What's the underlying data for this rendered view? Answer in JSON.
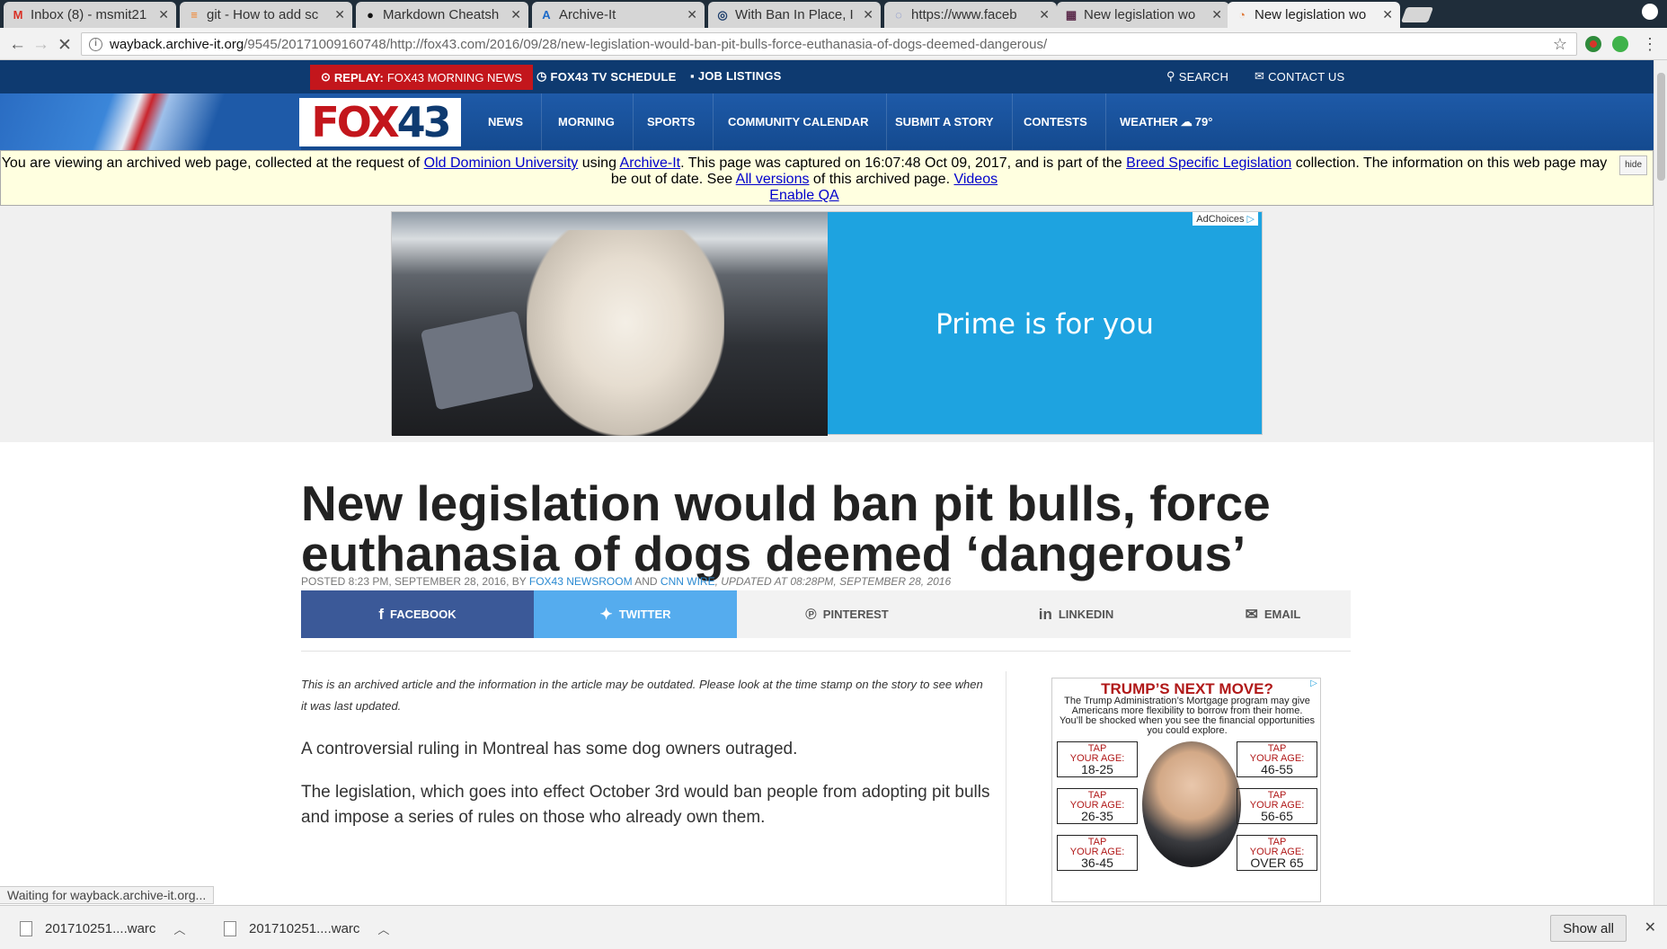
{
  "browser": {
    "tabs": [
      {
        "label": "Inbox (8) - msmit21",
        "icon": "gmail-icon",
        "icon_char": "M",
        "icon_color": "#d93025"
      },
      {
        "label": "git - How to add sc",
        "icon": "stackoverflow-icon",
        "icon_char": "≡",
        "icon_color": "#f48024"
      },
      {
        "label": "Markdown Cheatsh",
        "icon": "github-icon",
        "icon_char": "●",
        "icon_color": "#111111"
      },
      {
        "label": "Archive-It",
        "icon": "archive-it-icon",
        "icon_char": "A",
        "icon_color": "#1b6ac9"
      },
      {
        "label": "With Ban In Place, I",
        "icon": "news-site-icon",
        "icon_char": "◎",
        "icon_color": "#1d3d6b"
      },
      {
        "label": "https://www.faceb",
        "icon": "globe-icon",
        "icon_char": "◌",
        "icon_color": "#6b7ec9"
      },
      {
        "label": "New legislation wo",
        "icon": "fox43-icon",
        "icon_char": "▦",
        "icon_color": "#5a2a4a"
      },
      {
        "label": "New legislation wo",
        "icon": "loading-spinner-icon",
        "icon_char": "◔",
        "icon_color": "#e07a3a"
      }
    ],
    "address": {
      "host": "wayback.archive-it.org",
      "path": "/9545/20171009160748/http://fox43.com/2016/09/28/new-legislation-would-ban-pit-bulls-force-euthanasia-of-dogs-deemed-dangerous/"
    },
    "status_text": "Waiting for wayback.archive-it.org...",
    "downloads": [
      "201710251....warc",
      "201710251....warc"
    ],
    "show_all_label": "Show all"
  },
  "site": {
    "replay": {
      "label": "REPLAY:",
      "text": "FOX43 MORNING NEWS"
    },
    "top_links": {
      "schedule": "FOX43 TV SCHEDULE",
      "jobs": "JOB LISTINGS",
      "search": "SEARCH",
      "contact": "CONTACT US"
    },
    "logo": {
      "fox": "FOX",
      "num": "43"
    },
    "nav": [
      "NEWS",
      "MORNING",
      "SPORTS",
      "COMMUNITY CALENDAR",
      "SUBMIT A STORY",
      "CONTESTS",
      "WEATHER",
      "79°"
    ]
  },
  "archive_banner": {
    "t1": "You are viewing an archived web page, collected at the request of ",
    "org": "Old Dominion University",
    "t2": " using ",
    "tool": "Archive-It",
    "t3": ". This page was captured on 16:07:48 Oct 09, 2017, and is part of the ",
    "collection": "Breed Specific Legislation",
    "t4": " collection. The information on this web page may be out of date. See ",
    "versions": "All versions",
    "t5": " of this archived page. ",
    "videos": "Videos",
    "qa": "Enable QA",
    "hide": "hide"
  },
  "top_ad": {
    "text": "Prime is for you",
    "adchoices": "AdChoices"
  },
  "article": {
    "headline": "New legislation would ban pit bulls, force euthanasia of dogs deemed ‘dangerous’",
    "byline": {
      "posted": "POSTED 8:23 PM, SEPTEMBER 28, 2016, BY ",
      "author1": "FOX43 NEWSROOM",
      "and": " AND ",
      "author2": "CNN WIRE",
      "updated": ", UPDATED AT 08:28PM, SEPTEMBER 28, 2016"
    },
    "share": {
      "facebook": "FACEBOOK",
      "twitter": "TWITTER",
      "pinterest": "PINTEREST",
      "linkedin": "LINKEDIN",
      "email": "EMAIL"
    },
    "archived_note": "This is an archived article and the information in the article may be outdated. Please look at the time stamp on the story to see when it was last updated.",
    "p1": "A controversial ruling in Montreal has some dog owners outraged.",
    "p2": "The legislation, which goes into effect October 3rd would ban people from adopting pit bulls and impose a series of rules on those who already own them."
  },
  "side_ad": {
    "title": "TRUMP’S NEXT MOVE?",
    "body": "The Trump Administration’s Mortgage program may give Americans more flexibility to borrow from their home. You’ll be shocked when you see the financial opportunities you could explore.",
    "tap": "TAP",
    "your_age": "YOUR AGE:",
    "ranges": [
      "18-25",
      "46-55",
      "26-35",
      "56-65",
      "36-45",
      "OVER 65"
    ]
  },
  "colors": {
    "fox_red": "#c3161c",
    "fox_blue": "#0e3a70",
    "facebook": "#3b5998",
    "twitter": "#55acee",
    "link": "#0000cc"
  }
}
